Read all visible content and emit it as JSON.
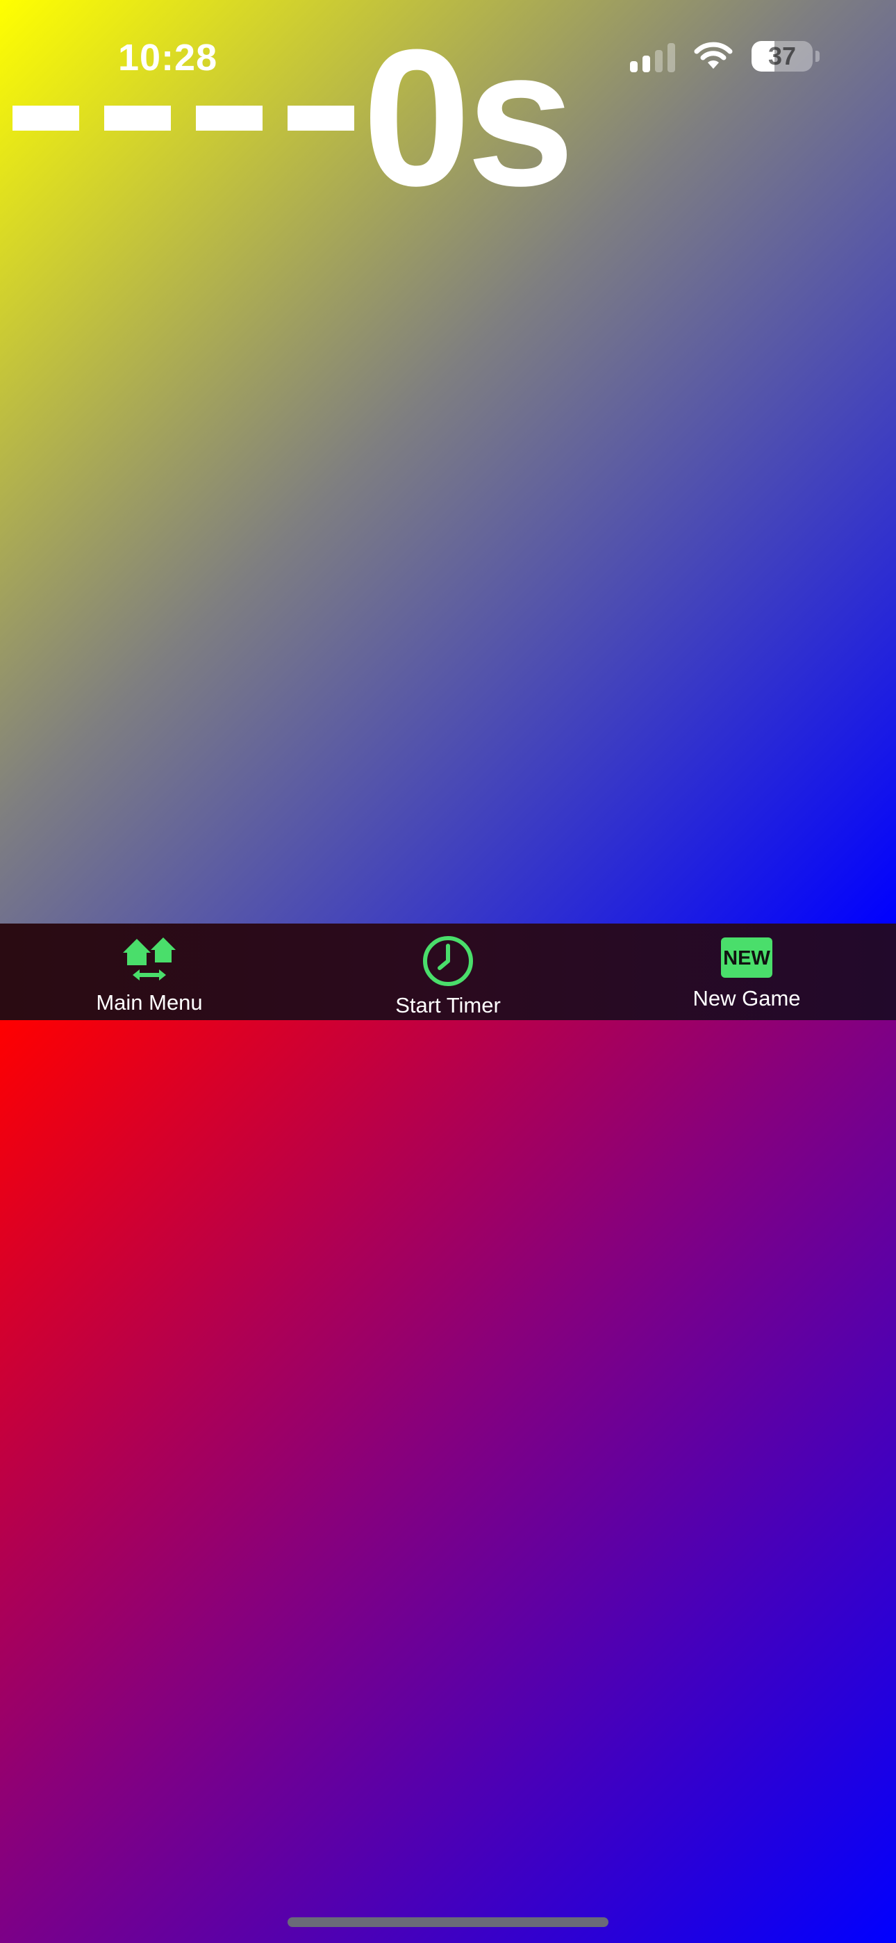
{
  "status_bar": {
    "time": "10:28",
    "battery_level": "37",
    "battery_fraction": 0.37,
    "signal_bars_active": 2,
    "signal_bars_total": 4,
    "icons": [
      "cellular-signal-icon",
      "wifi-icon",
      "battery-icon"
    ]
  },
  "timer": {
    "value": "0s",
    "dash_count": 4
  },
  "toolbar": {
    "items": [
      {
        "label": "Main Menu",
        "icon": "home-swap-icon"
      },
      {
        "label": "Start Timer",
        "icon": "clock-icon"
      },
      {
        "label": "New Game",
        "icon": "new-badge-icon",
        "badge_text": "NEW"
      }
    ],
    "accent_color": "#4ade6b"
  },
  "panels": {
    "top_gradient": [
      "#ffff00",
      "#0000ff"
    ],
    "bottom_gradient": [
      "#ff0000",
      "#0000ff"
    ]
  }
}
